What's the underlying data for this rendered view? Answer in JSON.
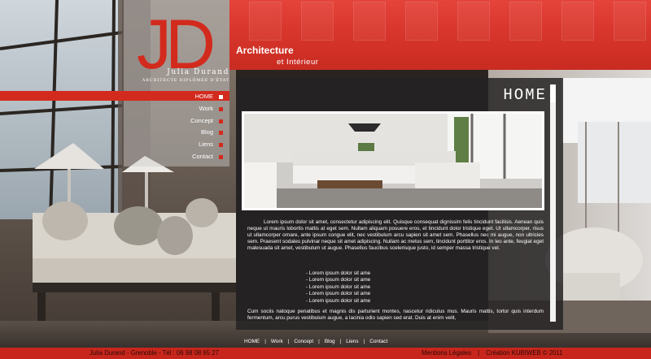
{
  "brand": {
    "monogram": "JD",
    "name": "Julia Durand",
    "subtitle": "Architecte Diplômée d'État"
  },
  "tagline": {
    "line1": "Architecture",
    "line2": "et Intérieur"
  },
  "nav": [
    {
      "label": "HOME",
      "active": true
    },
    {
      "label": "Work",
      "active": false
    },
    {
      "label": "Concept",
      "active": false
    },
    {
      "label": "Blog",
      "active": false
    },
    {
      "label": "Liens",
      "active": false
    },
    {
      "label": "Contact",
      "active": false
    }
  ],
  "page": {
    "title": "HOME",
    "paragraph1": "Lorem ipsum dolor sit amet, consectetur adipiscing elit. Quisque consequat dignissim felis tincidunt facilisis. Aenean quis neque ut mauris lobortis mattis at eget sem. Nullam aliquam posuere eros, et tincidunt dolor tristique eget. Ut ullamcorper, risus ut ullamcorper ornare, ante ipsum congue elit, nec vestibulum arcu sapien sit amet sem. Phasellus nec mi augue, non ultricies sem. Praesent sodales pulvinar neque sit amet adipiscing. Nullam ac metus sem, tincidunt porttitor eros. In leo ante, feugiat eget malesuada sit amet, vestibulum ut augue. Phasellus faucibus scelerisque justo, id semper massa tristique vel.",
    "bullets": [
      "- Lorem ipsum dolor sit ame",
      "- Lorem ipsum dolor sit ame",
      "- Lorem ipsum dolor sit ame",
      "- Lorem ipsum dolor sit ame",
      "- Lorem ipsum dolor sit ame"
    ],
    "paragraph2": "Cum sociis natoque penatibus et magnis dis parturient montes, nascetur ridiculus mus. Mauris mattis, tortor quis interdum fermentum, arcu purus vestibulum augue, a lacinia odio sapien sed erat. Duis at enim velit,"
  },
  "footer_nav": [
    "HOME",
    "Work",
    "Concept",
    "Blog",
    "Liens",
    "Contact"
  ],
  "footer": {
    "left": "Julia Durand - Grenoble - Tél : 06 98 08 65 27",
    "legal": "Mentions Légales",
    "separator": "|",
    "credit": "Création KUBIWEB © 2011"
  },
  "colors": {
    "accent": "#d32a1e",
    "panel": "#242222",
    "text": "#ffffff"
  }
}
